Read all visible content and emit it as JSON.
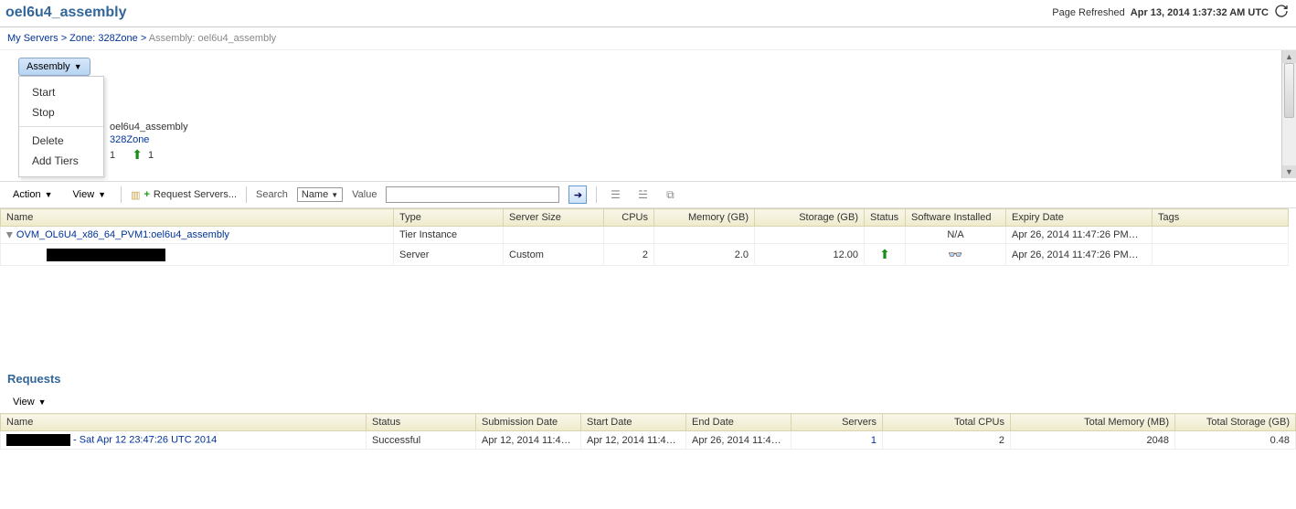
{
  "header": {
    "title": "oel6u4_assembly",
    "refreshed_label": "Page Refreshed",
    "refreshed_ts": "Apr 13, 2014 1:37:32 AM UTC"
  },
  "breadcrumb": {
    "a": "My Servers",
    "b": "Zone: 328Zone",
    "current": "Assembly: oel6u4_assembly"
  },
  "assembly_button": "Assembly",
  "menu": {
    "start": "Start",
    "stop": "Stop",
    "delete": "Delete",
    "add_tiers": "Add Tiers"
  },
  "detail": {
    "name": "oel6u4_assembly",
    "zone": "328Zone",
    "count1": "1",
    "count2": "1"
  },
  "servers": {
    "toolbar": {
      "action": "Action",
      "view": "View",
      "request_servers": "Request Servers...",
      "search_label": "Search",
      "search_field": "Name",
      "value_label": "Value"
    },
    "columns": {
      "name": "Name",
      "type": "Type",
      "server_size": "Server Size",
      "cpus": "CPUs",
      "memory": "Memory (GB)",
      "storage": "Storage (GB)",
      "status": "Status",
      "software": "Software Installed",
      "expiry": "Expiry Date",
      "tags": "Tags"
    },
    "rows": [
      {
        "name": "OVM_OL6U4_x86_64_PVM1:oel6u4_assembly",
        "type": "Tier Instance",
        "server_size": "",
        "cpus": "",
        "memory": "",
        "storage": "",
        "status": "",
        "software": "N/A",
        "expiry": "Apr 26, 2014 11:47:26 PM…",
        "tags": ""
      },
      {
        "name": "",
        "type": "Server",
        "server_size": "Custom",
        "cpus": "2",
        "memory": "2.0",
        "storage": "12.00",
        "status": "up",
        "software": "glasses",
        "expiry": "Apr 26, 2014 11:47:26 PM…",
        "tags": ""
      }
    ]
  },
  "requests": {
    "title": "Requests",
    "view": "View",
    "columns": {
      "name": "Name",
      "status": "Status",
      "submission": "Submission Date",
      "start": "Start Date",
      "end": "End Date",
      "servers": "Servers",
      "total_cpus": "Total CPUs",
      "total_mem": "Total Memory (MB)",
      "total_storage": "Total Storage (GB)"
    },
    "rows": [
      {
        "suffix": " - Sat Apr 12 23:47:26 UTC 2014",
        "status": "Successful",
        "submission": "Apr 12, 2014 11:4…",
        "start": "Apr 12, 2014 11:4…",
        "end": "Apr 26, 2014 11:4…",
        "servers": "1",
        "total_cpus": "2",
        "total_mem": "2048",
        "total_storage": "0.48"
      }
    ]
  }
}
